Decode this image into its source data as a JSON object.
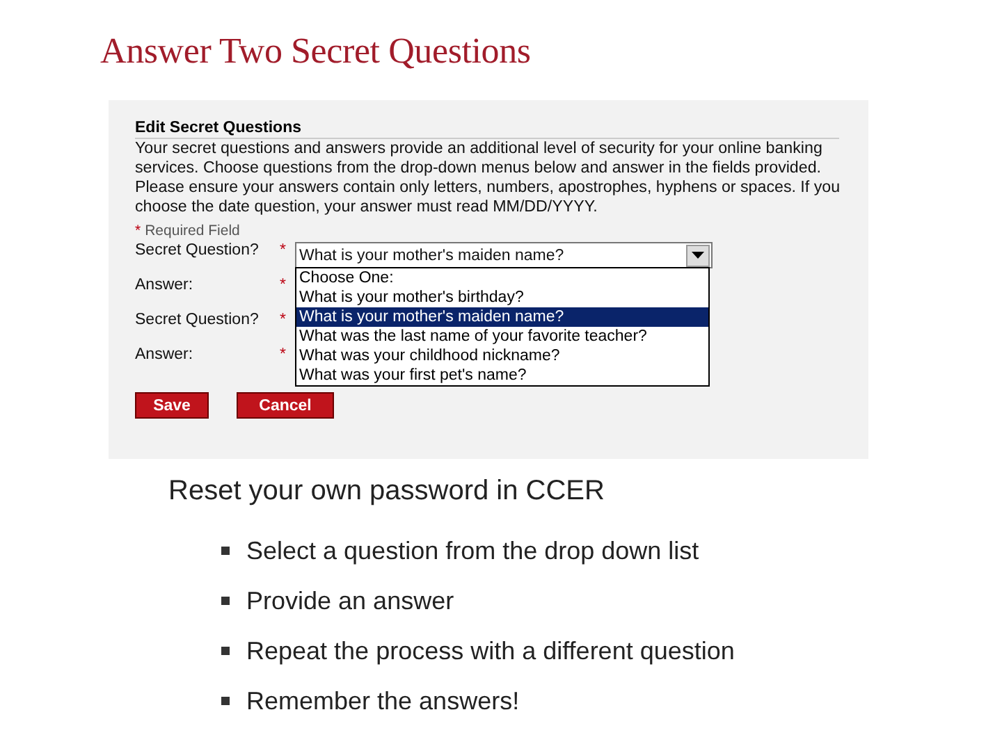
{
  "slide": {
    "title": "Answer Two Secret Questions"
  },
  "form": {
    "heading": "Edit Secret Questions",
    "intro": "Your secret questions and answers provide an additional level of security for your online banking services. Choose questions from the drop-down menus below and answer in the fields provided. Please ensure your answers contain only letters, numbers, apostrophes, hyphens or spaces. If you choose the date question, your answer must read MM/DD/YYYY.",
    "required_note": {
      "mark": "*",
      "text": "Required Field"
    },
    "rows": [
      {
        "kind": "question",
        "label": "Secret Question?",
        "mark": "*",
        "value": "What is your mother's maiden name?"
      },
      {
        "kind": "answer",
        "label": "Answer:",
        "mark": "*"
      },
      {
        "kind": "question",
        "label": "Secret Question?",
        "mark": "*"
      },
      {
        "kind": "answer",
        "label": "Answer:",
        "mark": "*"
      }
    ],
    "dropdown": {
      "options": [
        {
          "label": "Choose One:",
          "selected": false
        },
        {
          "label": "What is your mother's birthday?",
          "selected": false
        },
        {
          "label": "What is your mother's maiden name?",
          "selected": true
        },
        {
          "label": "What was the last name of your favorite teacher?",
          "selected": false
        },
        {
          "label": "What was your childhood nickname?",
          "selected": false
        },
        {
          "label": "What was your first pet's name?",
          "selected": false
        }
      ]
    },
    "buttons": [
      "Save",
      "Cancel"
    ]
  },
  "body": {
    "heading": "Reset your own password in CCER",
    "bullets": [
      "Select a question from the drop down list",
      "Provide an answer",
      "Repeat the process with a different question",
      "Remember the answers!"
    ]
  }
}
